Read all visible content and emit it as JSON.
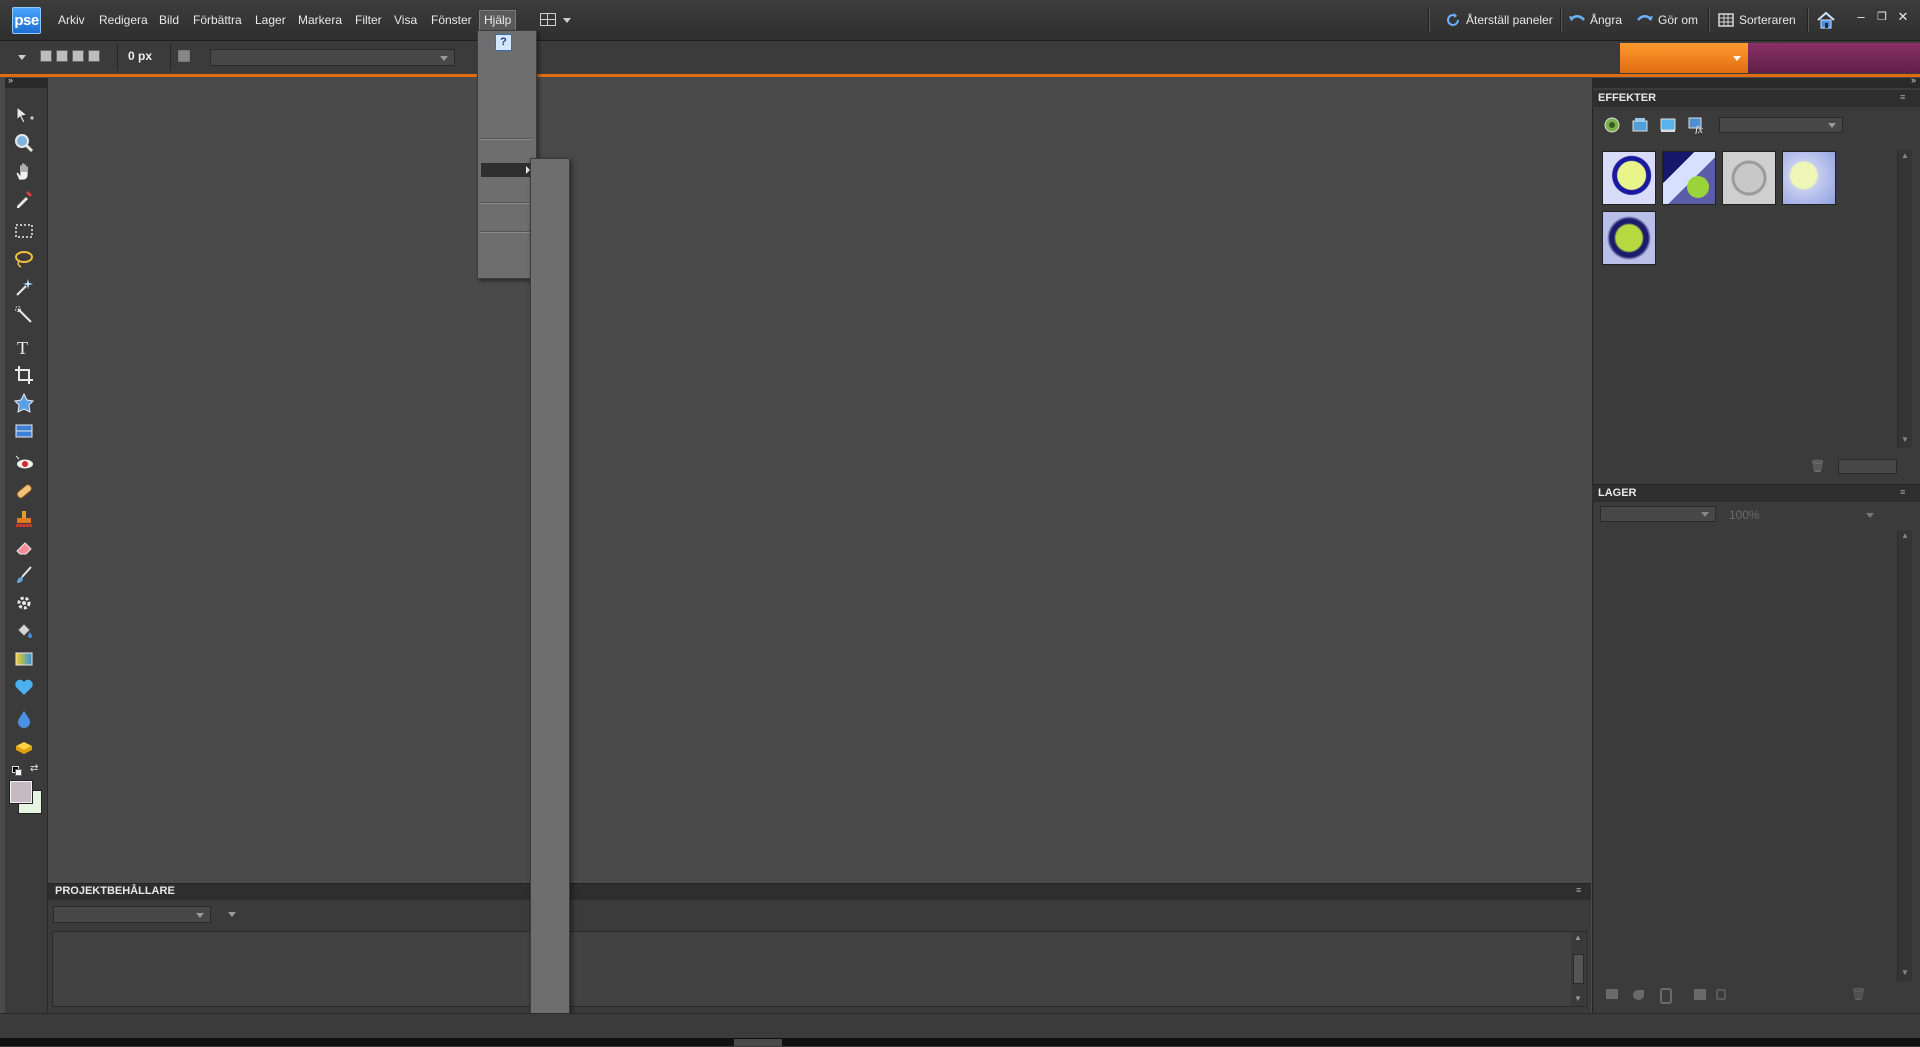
{
  "app": {
    "logo": "pse"
  },
  "menubar": {
    "items": [
      "Arkiv",
      "Redigera",
      "Bild",
      "Förbättra",
      "Lager",
      "Markera",
      "Filter",
      "Visa",
      "Fönster",
      "Hjälp"
    ],
    "active_index": 9
  },
  "toolbar_right": {
    "reset_panels": "Återställ paneler",
    "undo": "Ångra",
    "redo": "Gör om",
    "organizer": "Sorteraren"
  },
  "window_controls": {
    "minimize": "–",
    "restore": "❐",
    "close": "✕"
  },
  "options_bar": {
    "feather_value": "0 px"
  },
  "help_menu": {
    "help_icon": "?"
  },
  "project_bin": {
    "title": "PROJEKTBEHÅLLARE"
  },
  "effects_panel": {
    "title": "EFFEKTER",
    "thumbnails": 5
  },
  "layers_panel": {
    "title": "LAGER",
    "opacity": "100%"
  },
  "colors": {
    "accent_orange": "#e06d12",
    "accent_purple": "#6e2755",
    "logo_blue": "#2b85e8",
    "foreground_swatch": "#c7b9c1",
    "background_swatch": "#e6f5e1"
  }
}
